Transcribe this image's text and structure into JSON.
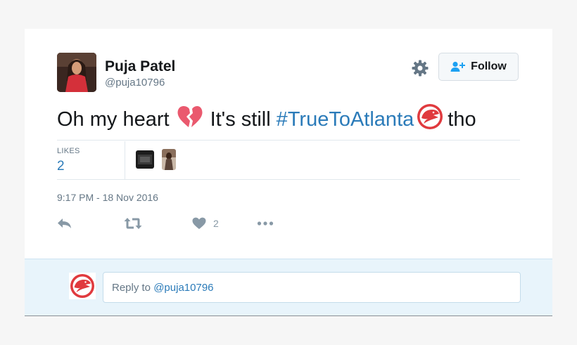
{
  "user": {
    "name": "Puja Patel",
    "handle": "@puja10796"
  },
  "follow_button": {
    "label": "Follow"
  },
  "tweet": {
    "text_part1": "Oh my heart",
    "text_part2": "It's still",
    "hashtag": "#TrueToAtlanta",
    "text_part3": "tho"
  },
  "stats": {
    "likes_label": "LIKES",
    "likes_count": "2"
  },
  "timestamp": "9:17 PM - 18 Nov 2016",
  "actions": {
    "like_count": "2"
  },
  "reply": {
    "prefix": "Reply to ",
    "mention": "@puja10796"
  },
  "colors": {
    "link": "#2b7bb9",
    "muted": "#657786",
    "hawks_red": "#e03a3e",
    "reply_bg": "#e8f4fb"
  },
  "icons": [
    "gear-icon",
    "follow-person-icon",
    "broken-heart-icon",
    "hawks-logo-icon",
    "reply-icon",
    "retweet-icon",
    "heart-icon",
    "more-icon"
  ]
}
